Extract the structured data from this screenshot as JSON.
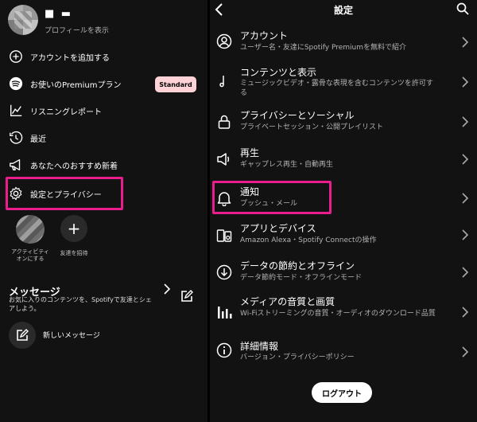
{
  "left": {
    "profile": {
      "name": "■ ▬",
      "subtitle": "プロフィールを表示"
    },
    "menu": [
      {
        "label": "アカウントを追加する",
        "icon": "plus-circle-icon"
      },
      {
        "label": "お使いのPremiumプラン",
        "icon": "spotify-icon"
      },
      {
        "label": "リスニングレポート",
        "icon": "chart-line-icon"
      },
      {
        "label": "最近",
        "icon": "history-clock-icon"
      },
      {
        "label": "あなたへのおすすめ新着",
        "icon": "megaphone-icon"
      },
      {
        "label": "設定とプライバシー",
        "icon": "gear-icon"
      }
    ],
    "premium_badge": "Standard",
    "activity": {
      "caption_line1": "アクティビティ",
      "caption_line2": "オンにする"
    },
    "invite": {
      "symbol": "+",
      "caption": "友達を招待"
    },
    "messages": {
      "title": "メッセージ",
      "subtitle": "お気に入りのコンテンツを、Spotifyで友達とシェアしよう。",
      "new_message": "新しいメッセージ"
    },
    "highlight_color": "#e91e8c"
  },
  "right": {
    "title": "設定",
    "rows": [
      {
        "title": "アカウント",
        "subtitle": "ユーザー名・友達にSpotify Premiumを無料で紹介",
        "icon": "user-circle-icon"
      },
      {
        "title": "コンテンツと表示",
        "subtitle": "ミュージックビデオ・露骨な表現を含むコンテンツを許可する",
        "icon": "music-note-icon"
      },
      {
        "title": "プライバシーとソーシャル",
        "subtitle": "プライベートセッション・公開プレイリスト",
        "icon": "lock-icon"
      },
      {
        "title": "再生",
        "subtitle": "ギャップレス再生・自動再生",
        "icon": "speaker-icon"
      },
      {
        "title": "通知",
        "subtitle": "プッシュ・メール",
        "icon": "bell-icon"
      },
      {
        "title": "アプリとデバイス",
        "subtitle": "Amazon Alexa・Spotify Connectの操作",
        "icon": "devices-icon"
      },
      {
        "title": "データの節約とオフライン",
        "subtitle": "データ節約モード・オフラインモード",
        "icon": "download-circle-icon"
      },
      {
        "title": "メディアの音質と画質",
        "subtitle": "Wi-Fiストリーミングの音質・オーディオのダウンロード品質",
        "icon": "bars-icon"
      },
      {
        "title": "詳細情報",
        "subtitle": "バージョン・プライバシーポリシー",
        "icon": "info-icon"
      }
    ],
    "logout": "ログアウト"
  }
}
